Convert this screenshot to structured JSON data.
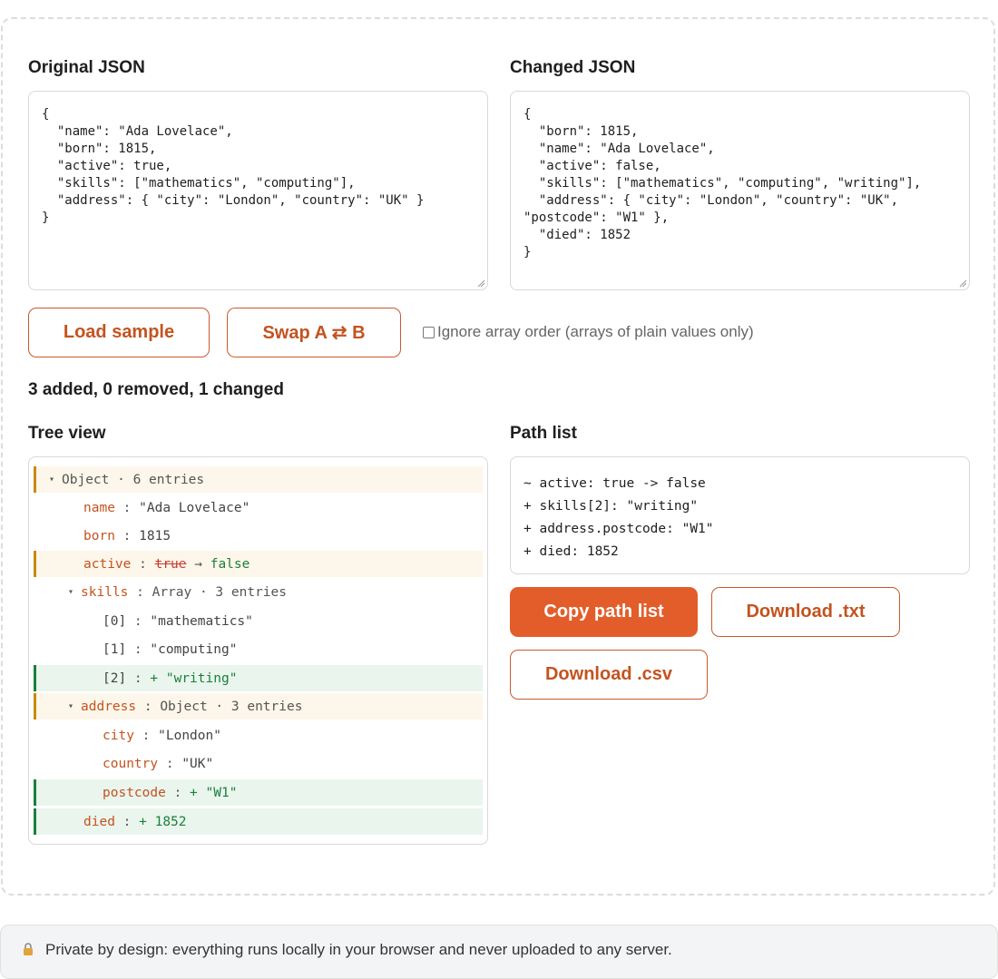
{
  "original": {
    "label": "Original JSON",
    "text": "{\n  \"name\": \"Ada Lovelace\",\n  \"born\": 1815,\n  \"active\": true,\n  \"skills\": [\"mathematics\", \"computing\"],\n  \"address\": { \"city\": \"London\", \"country\": \"UK\" }\n}"
  },
  "changed": {
    "label": "Changed JSON",
    "text": "{\n  \"born\": 1815,\n  \"name\": \"Ada Lovelace\",\n  \"active\": false,\n  \"skills\": [\"mathematics\", \"computing\", \"writing\"],\n  \"address\": { \"city\": \"London\", \"country\": \"UK\",\n\"postcode\": \"W1\" },\n  \"died\": 1852\n}"
  },
  "controls": {
    "load_sample": "Load sample",
    "swap": "Swap A ⇄ B",
    "ignore_order_label": "Ignore array order (arrays of plain values only)",
    "ignore_order_checked": false
  },
  "summary": "3 added, 0 removed, 1 changed",
  "tree": {
    "label": "Tree view",
    "rows": {
      "root": {
        "caret": "▾",
        "label": "Object · 6 entries"
      },
      "name": {
        "key": "name",
        "sep": " : ",
        "value": "\"Ada Lovelace\""
      },
      "born": {
        "key": "born",
        "sep": " : ",
        "value": "1815"
      },
      "active": {
        "key": "active",
        "sep": " : ",
        "old": "true",
        "arrow": " → ",
        "new": "false"
      },
      "skills": {
        "caret": "▾",
        "key": "skills",
        "sep": " : ",
        "meta": "Array · 3 entries"
      },
      "skills0": {
        "key": "[0]",
        "sep": " : ",
        "value": "\"mathematics\""
      },
      "skills1": {
        "key": "[1]",
        "sep": " : ",
        "value": "\"computing\""
      },
      "skills2": {
        "key": "[2]",
        "sep": " : ",
        "value": "+ \"writing\""
      },
      "address": {
        "caret": "▾",
        "key": "address",
        "sep": " : ",
        "meta": "Object · 3 entries"
      },
      "city": {
        "key": "city",
        "sep": " : ",
        "value": "\"London\""
      },
      "country": {
        "key": "country",
        "sep": " : ",
        "value": "\"UK\""
      },
      "postcode": {
        "key": "postcode",
        "sep": " : ",
        "value": "+ \"W1\""
      },
      "died": {
        "key": "died",
        "sep": " : ",
        "value": "+ 1852"
      }
    }
  },
  "pathlist": {
    "label": "Path list",
    "text": "~ active: true -> false\n+ skills[2]: \"writing\"\n+ address.postcode: \"W1\"\n+ died: 1852",
    "copy": "Copy path list",
    "download_txt": "Download .txt",
    "download_csv": "Download .csv"
  },
  "footer": {
    "icon": "lock-icon",
    "text": "Private by design: everything runs locally in your browser and never uploaded to any server."
  },
  "colors": {
    "accent": "#e35d2a",
    "added": "#1a7f3a",
    "changed": "#c98a10",
    "removed": "#c73d2e"
  }
}
